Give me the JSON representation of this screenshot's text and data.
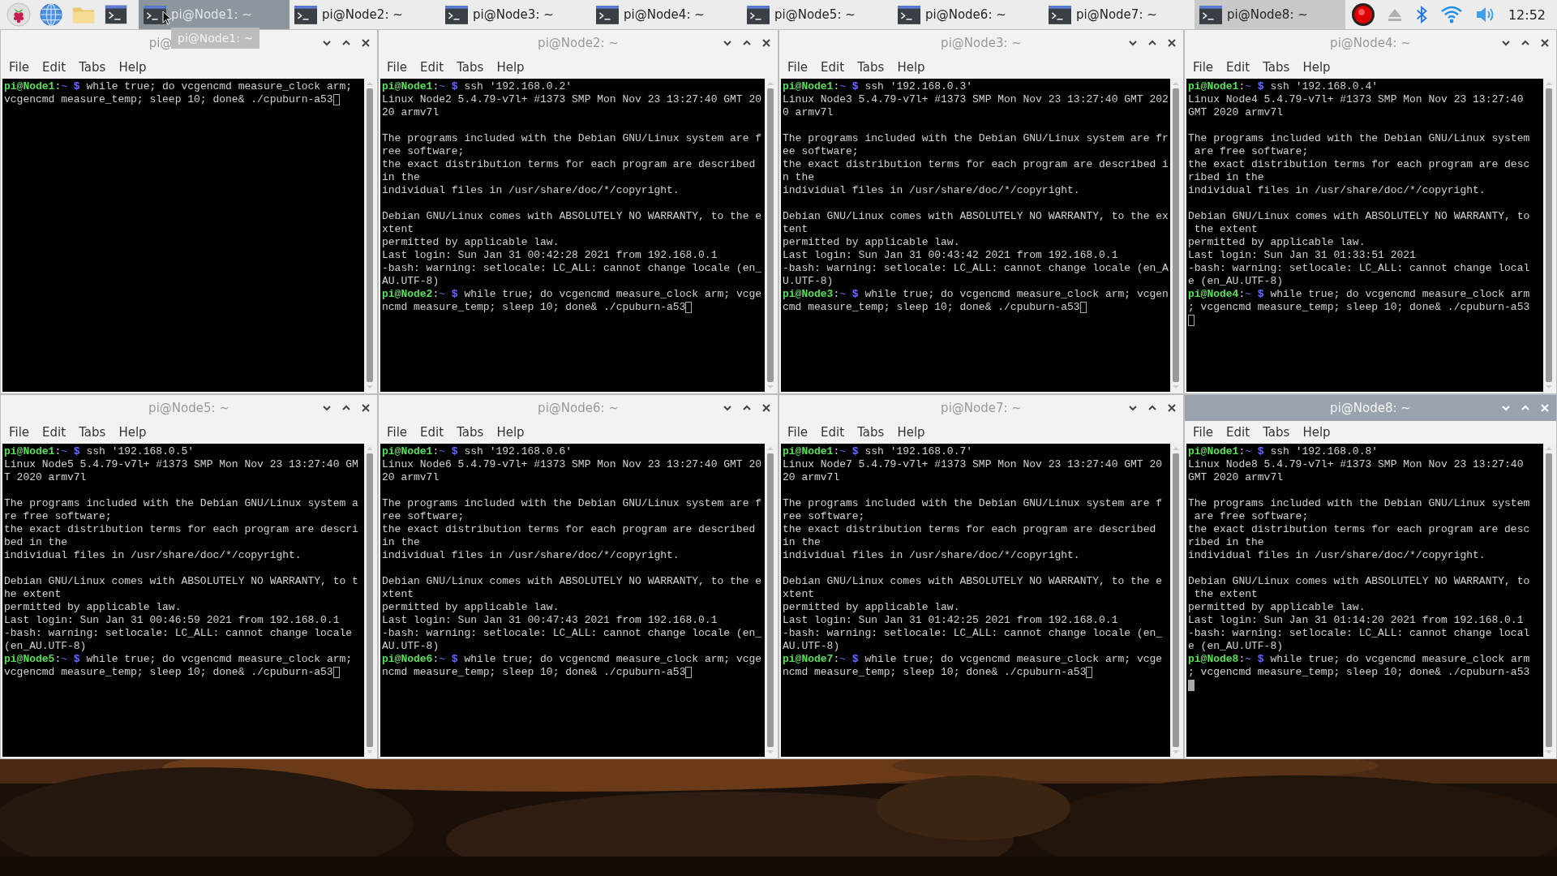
{
  "taskbar": {
    "tasks": [
      {
        "label": "pi@Node1: ~",
        "selected": false,
        "hovered": true
      },
      {
        "label": "pi@Node2: ~",
        "selected": false,
        "hovered": false
      },
      {
        "label": "pi@Node3: ~",
        "selected": false,
        "hovered": false
      },
      {
        "label": "pi@Node4: ~",
        "selected": false,
        "hovered": false
      },
      {
        "label": "pi@Node5: ~",
        "selected": false,
        "hovered": false
      },
      {
        "label": "pi@Node6: ~",
        "selected": false,
        "hovered": false
      },
      {
        "label": "pi@Node7: ~",
        "selected": false,
        "hovered": false
      },
      {
        "label": "pi@Node8: ~",
        "selected": true,
        "hovered": false
      }
    ],
    "clock": "12:52",
    "tooltip": "pi@Node1: ~"
  },
  "windows": [
    {
      "title": "pi@",
      "active": false,
      "menu": [
        "File",
        "Edit",
        "Tabs",
        "Help"
      ],
      "lines": [
        {
          "kind": "prompt",
          "host": "pi@Node1",
          "sep": ":",
          "path": "~",
          "sign": " $",
          "cmd": " while true; do vcgencmd measure_clock arm;"
        },
        {
          "kind": "text",
          "text": "vcgencmd measure_temp; sleep 10; done& ./cpuburn-a53",
          "cursor": true
        }
      ]
    },
    {
      "title": "pi@Node2: ~",
      "active": false,
      "menu": [
        "File",
        "Edit",
        "Tabs",
        "Help"
      ],
      "lines": [
        {
          "kind": "prompt",
          "host": "pi@Node1",
          "sep": ":",
          "path": "~",
          "sign": " $",
          "cmd": " ssh '192.168.0.2'"
        },
        {
          "kind": "text",
          "text": "Linux Node2 5.4.79-v7l+ #1373 SMP Mon Nov 23 13:27:40 GMT 20"
        },
        {
          "kind": "text",
          "text": "20 armv7l"
        },
        {
          "kind": "blank"
        },
        {
          "kind": "text",
          "text": "The programs included with the Debian GNU/Linux system are f"
        },
        {
          "kind": "text",
          "text": "ree software;"
        },
        {
          "kind": "text",
          "text": "the exact distribution terms for each program are described"
        },
        {
          "kind": "text",
          "text": "in the"
        },
        {
          "kind": "text",
          "text": "individual files in /usr/share/doc/*/copyright."
        },
        {
          "kind": "blank"
        },
        {
          "kind": "text",
          "text": "Debian GNU/Linux comes with ABSOLUTELY NO WARRANTY, to the e"
        },
        {
          "kind": "text",
          "text": "xtent"
        },
        {
          "kind": "text",
          "text": "permitted by applicable law."
        },
        {
          "kind": "text",
          "text": "Last login: Sun Jan 31 00:42:28 2021 from 192.168.0.1"
        },
        {
          "kind": "text",
          "text": "-bash: warning: setlocale: LC_ALL: cannot change locale (en_"
        },
        {
          "kind": "text",
          "text": "AU.UTF-8)"
        },
        {
          "kind": "prompt",
          "host": "pi@Node2",
          "sep": ":",
          "path": "~",
          "sign": " $",
          "cmd": " while true; do vcgencmd measure_clock arm; vcge"
        },
        {
          "kind": "text",
          "text": "ncmd measure_temp; sleep 10; done& ./cpuburn-a53",
          "cursor": true
        }
      ]
    },
    {
      "title": "pi@Node3: ~",
      "active": false,
      "menu": [
        "File",
        "Edit",
        "Tabs",
        "Help"
      ],
      "lines": [
        {
          "kind": "prompt",
          "host": "pi@Node1",
          "sep": ":",
          "path": "~",
          "sign": " $",
          "cmd": " ssh '192.168.0.3'"
        },
        {
          "kind": "text",
          "text": "Linux Node3 5.4.79-v7l+ #1373 SMP Mon Nov 23 13:27:40 GMT 202"
        },
        {
          "kind": "text",
          "text": "0 armv7l"
        },
        {
          "kind": "blank"
        },
        {
          "kind": "text",
          "text": "The programs included with the Debian GNU/Linux system are fr"
        },
        {
          "kind": "text",
          "text": "ee software;"
        },
        {
          "kind": "text",
          "text": "the exact distribution terms for each program are described i"
        },
        {
          "kind": "text",
          "text": "n the"
        },
        {
          "kind": "text",
          "text": "individual files in /usr/share/doc/*/copyright."
        },
        {
          "kind": "blank"
        },
        {
          "kind": "text",
          "text": "Debian GNU/Linux comes with ABSOLUTELY NO WARRANTY, to the ex"
        },
        {
          "kind": "text",
          "text": "tent"
        },
        {
          "kind": "text",
          "text": "permitted by applicable law."
        },
        {
          "kind": "text",
          "text": "Last login: Sun Jan 31 00:43:42 2021 from 192.168.0.1"
        },
        {
          "kind": "text",
          "text": "-bash: warning: setlocale: LC_ALL: cannot change locale (en_A"
        },
        {
          "kind": "text",
          "text": "U.UTF-8)"
        },
        {
          "kind": "prompt",
          "host": "pi@Node3",
          "sep": ":",
          "path": "~",
          "sign": " $",
          "cmd": " while true; do vcgencmd measure_clock arm; vcgen"
        },
        {
          "kind": "text",
          "text": "cmd measure_temp; sleep 10; done& ./cpuburn-a53",
          "cursor": true
        }
      ]
    },
    {
      "title": "pi@Node4: ~",
      "active": false,
      "menu": [
        "File",
        "Edit",
        "Tabs",
        "Help"
      ],
      "lines": [
        {
          "kind": "prompt",
          "host": "pi@Node1",
          "sep": ":",
          "path": "~",
          "sign": " $",
          "cmd": " ssh '192.168.0.4'"
        },
        {
          "kind": "text",
          "text": "Linux Node4 5.4.79-v7l+ #1373 SMP Mon Nov 23 13:27:40"
        },
        {
          "kind": "text",
          "text": "GMT 2020 armv7l"
        },
        {
          "kind": "blank"
        },
        {
          "kind": "text",
          "text": "The programs included with the Debian GNU/Linux system"
        },
        {
          "kind": "text",
          "text": " are free software;"
        },
        {
          "kind": "text",
          "text": "the exact distribution terms for each program are desc"
        },
        {
          "kind": "text",
          "text": "ribed in the"
        },
        {
          "kind": "text",
          "text": "individual files in /usr/share/doc/*/copyright."
        },
        {
          "kind": "blank"
        },
        {
          "kind": "text",
          "text": "Debian GNU/Linux comes with ABSOLUTELY NO WARRANTY, to"
        },
        {
          "kind": "text",
          "text": " the extent"
        },
        {
          "kind": "text",
          "text": "permitted by applicable law."
        },
        {
          "kind": "text",
          "text": "Last login: Sun Jan 31 01:33:51 2021"
        },
        {
          "kind": "text",
          "text": "-bash: warning: setlocale: LC_ALL: cannot change local"
        },
        {
          "kind": "text",
          "text": "e (en_AU.UTF-8)"
        },
        {
          "kind": "prompt",
          "host": "pi@Node4",
          "sep": ":",
          "path": "~",
          "sign": " $",
          "cmd": " while true; do vcgencmd measure_clock arm"
        },
        {
          "kind": "text",
          "text": "; vcgencmd measure_temp; sleep 10; done& ./cpuburn-a53"
        },
        {
          "kind": "cursor"
        }
      ]
    },
    {
      "title": "pi@Node5: ~",
      "active": false,
      "menu": [
        "File",
        "Edit",
        "Tabs",
        "Help"
      ],
      "lines": [
        {
          "kind": "prompt",
          "host": "pi@Node1",
          "sep": ":",
          "path": "~",
          "sign": " $",
          "cmd": " ssh '192.168.0.5'"
        },
        {
          "kind": "text",
          "text": "Linux Node5 5.4.79-v7l+ #1373 SMP Mon Nov 23 13:27:40 GM"
        },
        {
          "kind": "text",
          "text": "T 2020 armv7l"
        },
        {
          "kind": "blank"
        },
        {
          "kind": "text",
          "text": "The programs included with the Debian GNU/Linux system a"
        },
        {
          "kind": "text",
          "text": "re free software;"
        },
        {
          "kind": "text",
          "text": "the exact distribution terms for each program are descri"
        },
        {
          "kind": "text",
          "text": "bed in the"
        },
        {
          "kind": "text",
          "text": "individual files in /usr/share/doc/*/copyright."
        },
        {
          "kind": "blank"
        },
        {
          "kind": "text",
          "text": "Debian GNU/Linux comes with ABSOLUTELY NO WARRANTY, to t"
        },
        {
          "kind": "text",
          "text": "he extent"
        },
        {
          "kind": "text",
          "text": "permitted by applicable law."
        },
        {
          "kind": "text",
          "text": "Last login: Sun Jan 31 00:46:59 2021 from 192.168.0.1"
        },
        {
          "kind": "text",
          "text": "-bash: warning: setlocale: LC_ALL: cannot change locale"
        },
        {
          "kind": "text",
          "text": "(en_AU.UTF-8)"
        },
        {
          "kind": "prompt",
          "host": "pi@Node5",
          "sep": ":",
          "path": "~",
          "sign": " $",
          "cmd": " while true; do vcgencmd measure_clock arm;"
        },
        {
          "kind": "text",
          "text": "vcgencmd measure_temp; sleep 10; done& ./cpuburn-a53",
          "cursor": true
        }
      ]
    },
    {
      "title": "pi@Node6: ~",
      "active": false,
      "menu": [
        "File",
        "Edit",
        "Tabs",
        "Help"
      ],
      "lines": [
        {
          "kind": "prompt",
          "host": "pi@Node1",
          "sep": ":",
          "path": "~",
          "sign": " $",
          "cmd": " ssh '192.168.0.6'"
        },
        {
          "kind": "text",
          "text": "Linux Node6 5.4.79-v7l+ #1373 SMP Mon Nov 23 13:27:40 GMT 20"
        },
        {
          "kind": "text",
          "text": "20 armv7l"
        },
        {
          "kind": "blank"
        },
        {
          "kind": "text",
          "text": "The programs included with the Debian GNU/Linux system are f"
        },
        {
          "kind": "text",
          "text": "ree software;"
        },
        {
          "kind": "text",
          "text": "the exact distribution terms for each program are described"
        },
        {
          "kind": "text",
          "text": "in the"
        },
        {
          "kind": "text",
          "text": "individual files in /usr/share/doc/*/copyright."
        },
        {
          "kind": "blank"
        },
        {
          "kind": "text",
          "text": "Debian GNU/Linux comes with ABSOLUTELY NO WARRANTY, to the e"
        },
        {
          "kind": "text",
          "text": "xtent"
        },
        {
          "kind": "text",
          "text": "permitted by applicable law."
        },
        {
          "kind": "text",
          "text": "Last login: Sun Jan 31 00:47:43 2021 from 192.168.0.1"
        },
        {
          "kind": "text",
          "text": "-bash: warning: setlocale: LC_ALL: cannot change locale (en_"
        },
        {
          "kind": "text",
          "text": "AU.UTF-8)"
        },
        {
          "kind": "prompt",
          "host": "pi@Node6",
          "sep": ":",
          "path": "~",
          "sign": " $",
          "cmd": " while true; do vcgencmd measure_clock arm; vcge"
        },
        {
          "kind": "text",
          "text": "ncmd measure_temp; sleep 10; done& ./cpuburn-a53",
          "cursor": true
        }
      ]
    },
    {
      "title": "pi@Node7: ~",
      "active": false,
      "menu": [
        "File",
        "Edit",
        "Tabs",
        "Help"
      ],
      "lines": [
        {
          "kind": "prompt",
          "host": "pi@Node1",
          "sep": ":",
          "path": "~",
          "sign": " $",
          "cmd": " ssh '192.168.0.7'"
        },
        {
          "kind": "text",
          "text": "Linux Node7 5.4.79-v7l+ #1373 SMP Mon Nov 23 13:27:40 GMT 20"
        },
        {
          "kind": "text",
          "text": "20 armv7l"
        },
        {
          "kind": "blank"
        },
        {
          "kind": "text",
          "text": "The programs included with the Debian GNU/Linux system are f"
        },
        {
          "kind": "text",
          "text": "ree software;"
        },
        {
          "kind": "text",
          "text": "the exact distribution terms for each program are described"
        },
        {
          "kind": "text",
          "text": "in the"
        },
        {
          "kind": "text",
          "text": "individual files in /usr/share/doc/*/copyright."
        },
        {
          "kind": "blank"
        },
        {
          "kind": "text",
          "text": "Debian GNU/Linux comes with ABSOLUTELY NO WARRANTY, to the e"
        },
        {
          "kind": "text",
          "text": "xtent"
        },
        {
          "kind": "text",
          "text": "permitted by applicable law."
        },
        {
          "kind": "text",
          "text": "Last login: Sun Jan 31 01:42:25 2021 from 192.168.0.1"
        },
        {
          "kind": "text",
          "text": "-bash: warning: setlocale: LC_ALL: cannot change locale (en_"
        },
        {
          "kind": "text",
          "text": "AU.UTF-8)"
        },
        {
          "kind": "prompt",
          "host": "pi@Node7",
          "sep": ":",
          "path": "~",
          "sign": " $",
          "cmd": " while true; do vcgencmd measure_clock arm; vcge"
        },
        {
          "kind": "text",
          "text": "ncmd measure_temp; sleep 10; done& ./cpuburn-a53",
          "cursor": true
        }
      ]
    },
    {
      "title": "pi@Node8: ~",
      "active": true,
      "menu": [
        "File",
        "Edit",
        "Tabs",
        "Help"
      ],
      "lines": [
        {
          "kind": "prompt",
          "host": "pi@Node1",
          "sep": ":",
          "path": "~",
          "sign": " $",
          "cmd": " ssh '192.168.0.8'"
        },
        {
          "kind": "text",
          "text": "Linux Node8 5.4.79-v7l+ #1373 SMP Mon Nov 23 13:27:40"
        },
        {
          "kind": "text",
          "text": "GMT 2020 armv7l"
        },
        {
          "kind": "blank"
        },
        {
          "kind": "text",
          "text": "The programs included with the Debian GNU/Linux system"
        },
        {
          "kind": "text",
          "text": " are free software;"
        },
        {
          "kind": "text",
          "text": "the exact distribution terms for each program are desc"
        },
        {
          "kind": "text",
          "text": "ribed in the"
        },
        {
          "kind": "text",
          "text": "individual files in /usr/share/doc/*/copyright."
        },
        {
          "kind": "blank"
        },
        {
          "kind": "text",
          "text": "Debian GNU/Linux comes with ABSOLUTELY NO WARRANTY, to"
        },
        {
          "kind": "text",
          "text": " the extent"
        },
        {
          "kind": "text",
          "text": "permitted by applicable law."
        },
        {
          "kind": "text",
          "text": "Last login: Sun Jan 31 01:14:20 2021 from 192.168.0.1"
        },
        {
          "kind": "text",
          "text": "-bash: warning: setlocale: LC_ALL: cannot change local"
        },
        {
          "kind": "text",
          "text": "e (en_AU.UTF-8)"
        },
        {
          "kind": "prompt",
          "host": "pi@Node8",
          "sep": ":",
          "path": "~",
          "sign": " $",
          "cmd": " while true; do vcgencmd measure_clock arm"
        },
        {
          "kind": "text",
          "text": "; vcgencmd measure_temp; sleep 10; done& ./cpuburn-a53"
        },
        {
          "kind": "cursor"
        }
      ]
    }
  ]
}
